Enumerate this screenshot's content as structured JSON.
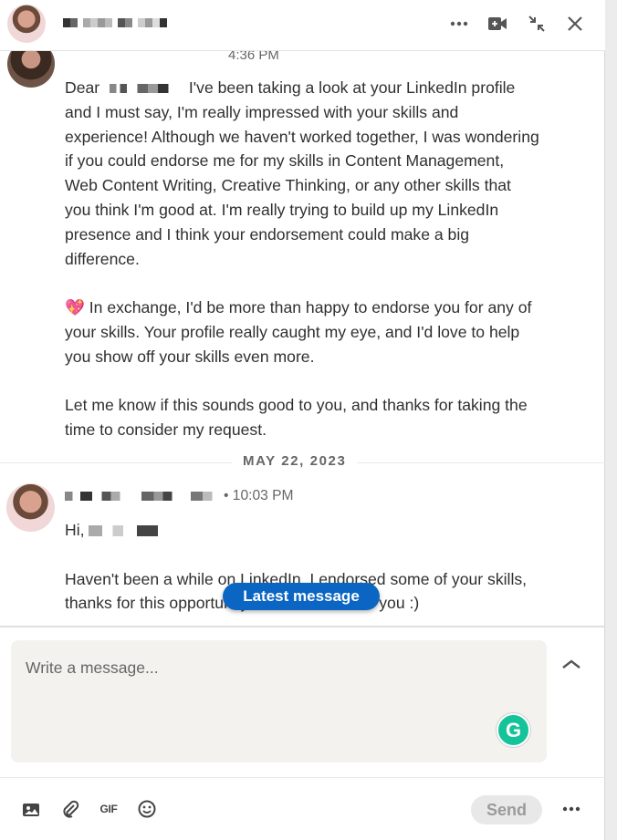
{
  "header": {
    "icons": [
      "more-icon",
      "video-icon",
      "minimize-icon",
      "close-icon"
    ]
  },
  "conversation": {
    "first_time_label": "4:36 PM",
    "first_message": {
      "greeting": "Dear",
      "paragraphs": [
        "I've been taking a look at your LinkedIn profile and I must say, I'm really impressed with your skills and experience! Although we haven't worked together, I was wondering if you could endorse me for my skills in Content Management, Web Content Writing, Creative Thinking, or any other skills that you think I'm good at. I'm really trying to build up my LinkedIn presence and I think your endorsement could make a big difference.",
        "💖 In exchange, I'd be more than happy to endorse you for any of your skills. Your profile really caught my eye, and I'd love to help you show off your skills even more.",
        "Let me know if this sounds good to you, and thanks for taking the time to consider my request."
      ]
    },
    "date_separator": "MAY 22, 2023",
    "second_message": {
      "time": "• 10:03 PM",
      "greeting": "Hi,",
      "body": "Haven't been a while on LinkedIn. I endorsed some of your skills, thanks for this opportunity to reconnect with you :)"
    },
    "latest_message_button": "Latest message"
  },
  "compose": {
    "placeholder": "Write a message...",
    "send_label": "Send",
    "gif_label": "GIF"
  },
  "colors": {
    "accent": "#0a66c2",
    "grammarly": "#15c39a",
    "compose_bg": "#f4f2ee"
  }
}
